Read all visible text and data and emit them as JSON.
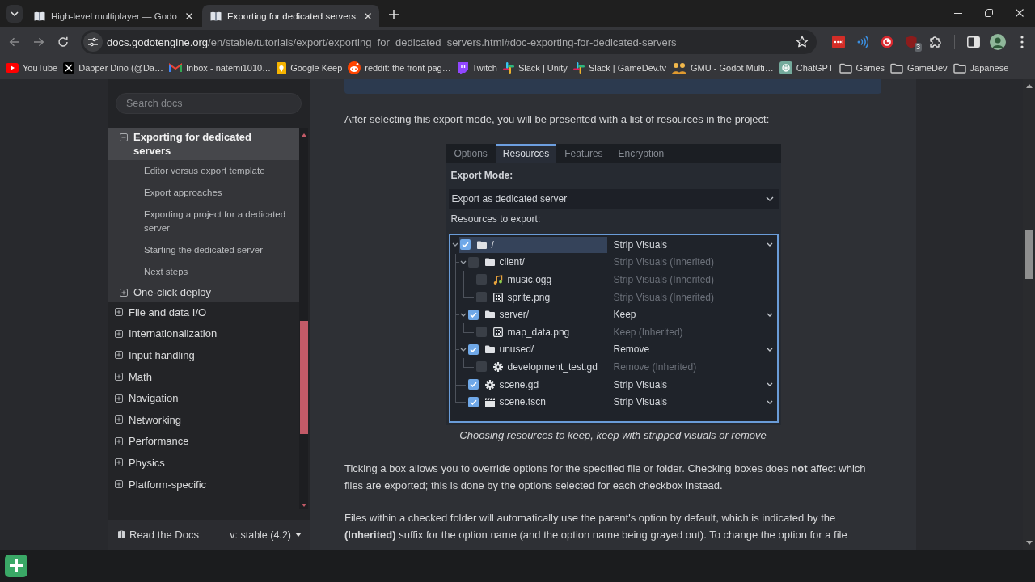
{
  "browser": {
    "tabs": [
      {
        "title": "High-level multiplayer — Godo",
        "selected": false
      },
      {
        "title": "Exporting for dedicated servers",
        "selected": true
      }
    ],
    "url": {
      "host": "docs.godotengine.org",
      "path": "/en/stable/tutorials/export/exporting_for_dedicated_servers.html#doc-exporting-for-dedicated-servers"
    },
    "extension_badge": "3",
    "bookmarks": [
      {
        "label": "YouTube",
        "kind": "youtube"
      },
      {
        "label": "Dapper Dino (@Da…",
        "kind": "x"
      },
      {
        "label": "Inbox - natemi1010…",
        "kind": "gmail"
      },
      {
        "label": "Google Keep",
        "kind": "keep"
      },
      {
        "label": "reddit: the front pag…",
        "kind": "reddit"
      },
      {
        "label": "Twitch",
        "kind": "twitch"
      },
      {
        "label": "Slack | Unity",
        "kind": "slack"
      },
      {
        "label": "Slack | GameDev.tv",
        "kind": "slack"
      },
      {
        "label": "GMU - Godot Multi…",
        "kind": "people"
      },
      {
        "label": "ChatGPT",
        "kind": "chatgpt"
      },
      {
        "label": "Games",
        "kind": "folder"
      },
      {
        "label": "GameDev",
        "kind": "folder"
      },
      {
        "label": "Japanese",
        "kind": "folder"
      }
    ]
  },
  "sidebar": {
    "search": {
      "placeholder": "Search docs"
    },
    "section_items": [
      {
        "label": "Exporting for dedicated servers",
        "expanded": true,
        "selected": true,
        "children": [
          {
            "label": "Editor versus export template",
            "selected": false
          },
          {
            "label": "Export approaches",
            "selected": false
          },
          {
            "label": "Exporting a project for a dedicated server",
            "selected": false
          },
          {
            "label": "Starting the dedicated server",
            "selected": false
          },
          {
            "label": "Next steps",
            "selected": false
          }
        ]
      },
      {
        "label": "One-click deploy",
        "expanded": false,
        "selected": false
      }
    ],
    "items": [
      {
        "label": "File and data I/O",
        "expanded": false,
        "selected": false
      },
      {
        "label": "Internationalization",
        "expanded": false,
        "selected": false
      },
      {
        "label": "Input handling",
        "expanded": false,
        "selected": false
      },
      {
        "label": "Math",
        "expanded": false,
        "selected": false
      },
      {
        "label": "Navigation",
        "expanded": false,
        "selected": false
      },
      {
        "label": "Networking",
        "expanded": false,
        "selected": false
      },
      {
        "label": "Performance",
        "expanded": false,
        "selected": false
      },
      {
        "label": "Physics",
        "expanded": false,
        "selected": false
      },
      {
        "label": "Platform-specific",
        "expanded": false,
        "selected": false
      }
    ],
    "footer": {
      "label": "Read the Docs",
      "version": "v: stable (4.2)"
    }
  },
  "article": {
    "intro": "After selecting this export mode, you will be presented with a list of resources in the project:",
    "figure": {
      "tabs": [
        {
          "label": "Options",
          "selected": false
        },
        {
          "label": "Resources",
          "selected": true
        },
        {
          "label": "Features",
          "selected": false
        },
        {
          "label": "Encryption",
          "selected": false
        }
      ],
      "export_mode_label": "Export Mode:",
      "export_mode": "Export as dedicated server",
      "resources_label": "Resources to export:",
      "tree": [
        {
          "name": "/",
          "kind": "folder",
          "checked": true,
          "expanded": true,
          "selected": true,
          "option": "Strip Visuals",
          "inherited": false,
          "children": [
            {
              "name": "client/",
              "kind": "folder",
              "checked": false,
              "expanded": true,
              "selected": false,
              "option": "Strip Visuals (Inherited)",
              "inherited": true,
              "children": [
                {
                  "name": "music.ogg",
                  "kind": "audio",
                  "checked": false,
                  "selected": false,
                  "option": "Strip Visuals (Inherited)",
                  "inherited": true
                },
                {
                  "name": "sprite.png",
                  "kind": "image",
                  "checked": false,
                  "selected": false,
                  "option": "Strip Visuals (Inherited)",
                  "inherited": true
                }
              ]
            },
            {
              "name": "server/",
              "kind": "folder",
              "checked": true,
              "expanded": true,
              "selected": false,
              "option": "Keep",
              "inherited": false,
              "children": [
                {
                  "name": "map_data.png",
                  "kind": "image",
                  "checked": false,
                  "selected": false,
                  "option": "Keep (Inherited)",
                  "inherited": true
                }
              ]
            },
            {
              "name": "unused/",
              "kind": "folder",
              "checked": true,
              "expanded": true,
              "selected": false,
              "option": "Remove",
              "inherited": false,
              "children": [
                {
                  "name": "development_test.gd",
                  "kind": "script",
                  "checked": false,
                  "selected": false,
                  "option": "Remove (Inherited)",
                  "inherited": true
                }
              ]
            },
            {
              "name": "scene.gd",
              "kind": "script",
              "checked": true,
              "selected": false,
              "option": "Strip Visuals",
              "inherited": false
            },
            {
              "name": "scene.tscn",
              "kind": "scene",
              "checked": true,
              "selected": false,
              "option": "Strip Visuals",
              "inherited": false
            }
          ]
        }
      ],
      "caption": "Choosing resources to keep, keep with stripped visuals or remove"
    },
    "paragraphs": [
      "Ticking a box allows you to override options for the specified file or folder. Checking boxes does **not** affect which files are exported; this is done by the options selected for each checkbox instead.",
      "Files within a checked folder will automatically use the parent's option by default, which is indicated by the **(Inherited)** suffix for the option name (and the option name being grayed out). To change the option for a file"
    ]
  }
}
